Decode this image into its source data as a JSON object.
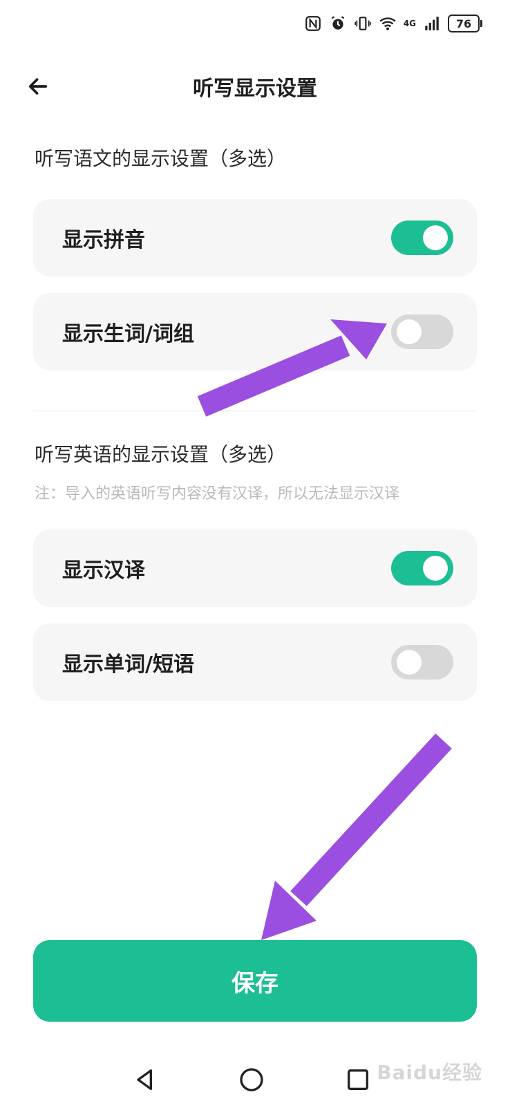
{
  "status_bar": {
    "network": "4G",
    "battery": "76"
  },
  "header": {
    "title": "听写显示设置"
  },
  "chinese_section": {
    "heading": "听写语文的显示设置（多选）",
    "items": [
      {
        "label": "显示拼音",
        "enabled": true
      },
      {
        "label": "显示生词/词组",
        "enabled": false
      }
    ]
  },
  "english_section": {
    "heading": "听写英语的显示设置（多选）",
    "note": "注：导入的英语听写内容没有汉译，所以无法显示汉译",
    "items": [
      {
        "label": "显示汉译",
        "enabled": true
      },
      {
        "label": "显示单词/短语",
        "enabled": false
      }
    ]
  },
  "save_button": {
    "label": "保存"
  },
  "colors": {
    "accent": "#1cbf93",
    "toggle_off": "#d8d8d8",
    "card_bg": "#f6f6f6",
    "annotation_arrow": "#9b4fe0"
  },
  "icons": {
    "back": "arrow-left-icon",
    "nav_back": "triangle-back-icon",
    "nav_home": "circle-home-icon",
    "nav_recents": "square-recents-icon"
  },
  "watermark": "Baidu经验"
}
